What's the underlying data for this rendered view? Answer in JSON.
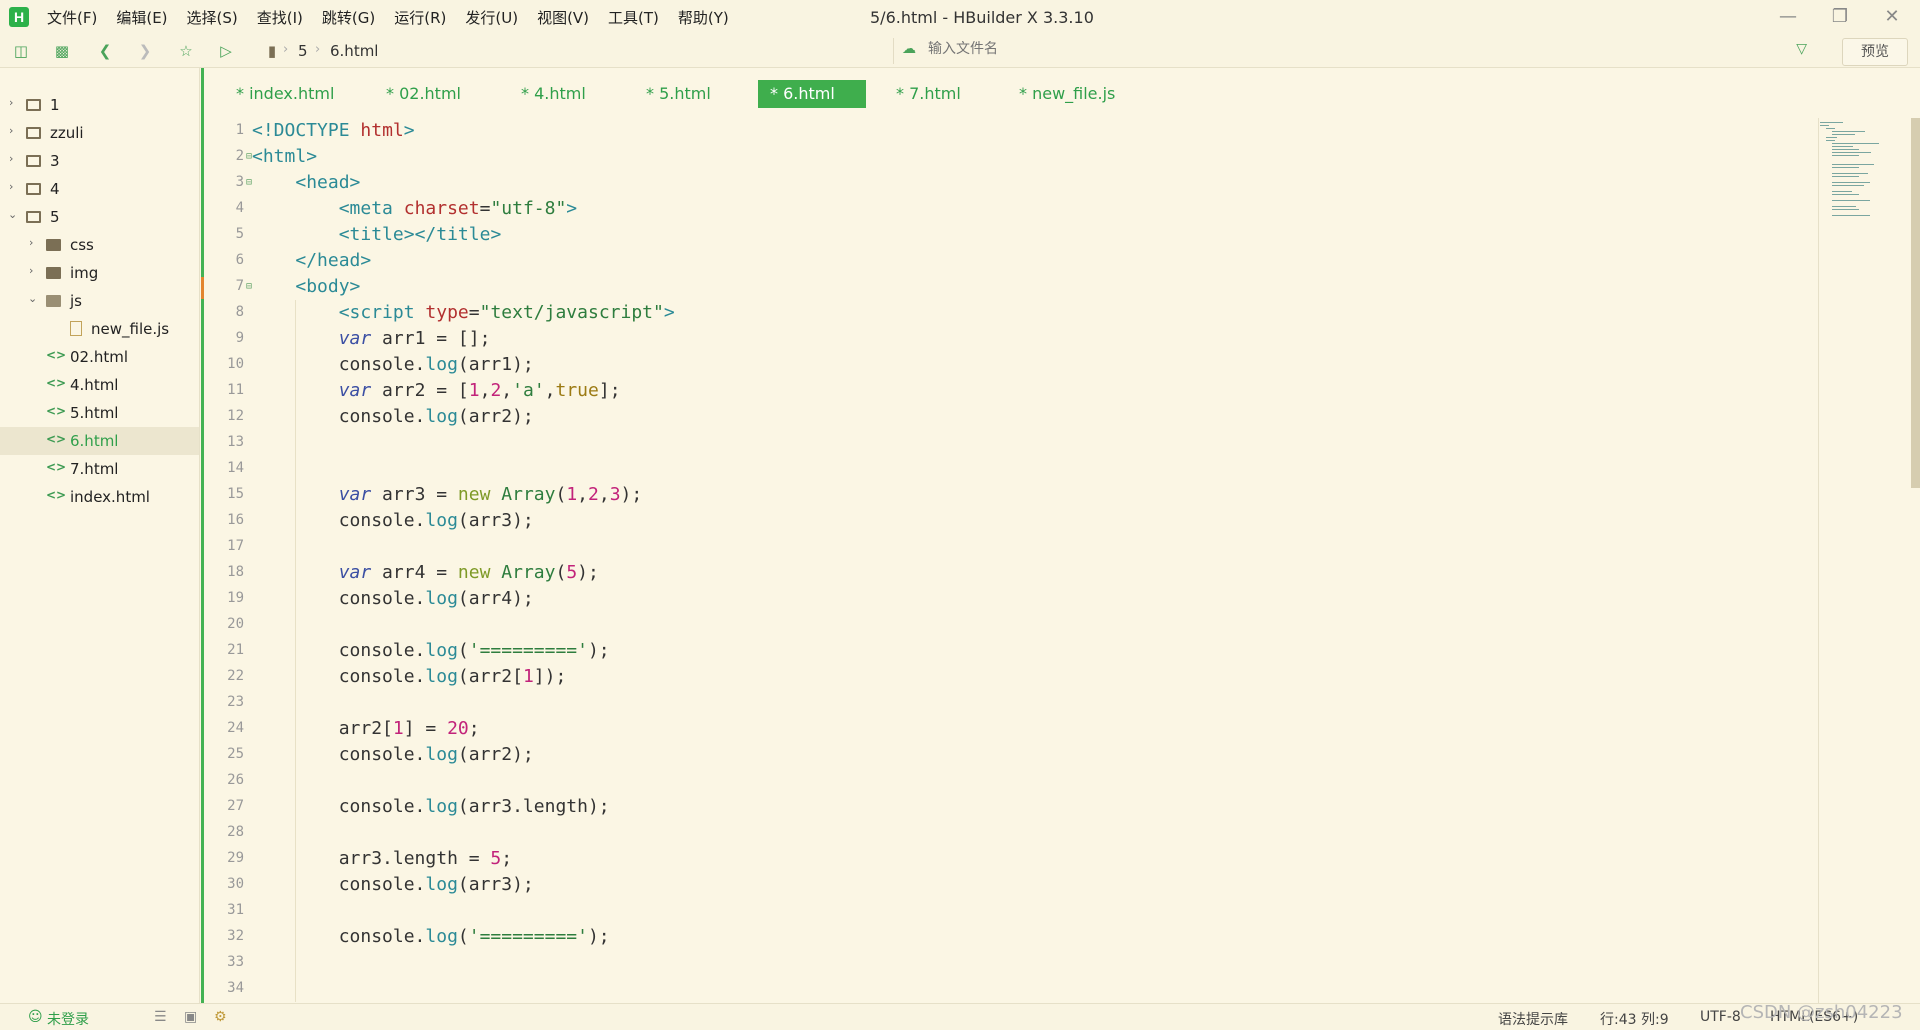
{
  "window": {
    "title": "5/6.html - HBuilder X 3.3.10",
    "logo": "H",
    "menu": [
      "文件(F)",
      "编辑(E)",
      "选择(S)",
      "查找(I)",
      "跳转(G)",
      "运行(R)",
      "发行(U)",
      "视图(V)",
      "工具(T)",
      "帮助(Y)"
    ]
  },
  "toolbar": {
    "breadcrumb": [
      "5",
      "6.html"
    ],
    "file_search_placeholder": "输入文件名",
    "preview_label": "预览"
  },
  "sidebar": {
    "items": [
      {
        "label": "1",
        "type": "project",
        "expanded": false
      },
      {
        "label": "zzuli",
        "type": "project",
        "expanded": false
      },
      {
        "label": "3",
        "type": "project",
        "expanded": false
      },
      {
        "label": "4",
        "type": "project",
        "expanded": false
      },
      {
        "label": "5",
        "type": "project",
        "expanded": true
      },
      {
        "label": "css",
        "type": "folder",
        "expanded": false
      },
      {
        "label": "img",
        "type": "folder",
        "expanded": false
      },
      {
        "label": "js",
        "type": "folder",
        "expanded": true
      },
      {
        "label": "new_file.js",
        "type": "js"
      },
      {
        "label": "02.html",
        "type": "html"
      },
      {
        "label": "4.html",
        "type": "html"
      },
      {
        "label": "5.html",
        "type": "html"
      },
      {
        "label": "6.html",
        "type": "html",
        "selected": true
      },
      {
        "label": "7.html",
        "type": "html"
      },
      {
        "label": "index.html",
        "type": "html"
      }
    ]
  },
  "tabs": [
    {
      "label": "* index.html"
    },
    {
      "label": "* 02.html"
    },
    {
      "label": "* 4.html"
    },
    {
      "label": "* 5.html"
    },
    {
      "label": "* 6.html",
      "active": true
    },
    {
      "label": "* 7.html"
    },
    {
      "label": "* new_file.js"
    }
  ],
  "editor": {
    "line_numbers": [
      "1",
      "2",
      "3",
      "4",
      "5",
      "6",
      "7",
      "8",
      "9",
      "10",
      "11",
      "12",
      "13",
      "14",
      "15",
      "16",
      "17",
      "18",
      "19",
      "20",
      "21",
      "22",
      "23",
      "24",
      "25",
      "26",
      "27",
      "28",
      "29",
      "30",
      "31",
      "32",
      "33",
      "34"
    ],
    "lines": [
      "<!DOCTYPE html>",
      "<html>",
      "    <head>",
      "        <meta charset=\"utf-8\">",
      "        <title></title>",
      "    </head>",
      "    <body>",
      "        <script type=\"text/javascript\">",
      "        var arr1 = [];",
      "        console.log(arr1);",
      "        var arr2 = [1,2,'a',true];",
      "        console.log(arr2);",
      "",
      "",
      "        var arr3 = new Array(1,2,3);",
      "        console.log(arr3);",
      "",
      "        var arr4 = new Array(5);",
      "        console.log(arr4);",
      "",
      "        console.log('=========');",
      "        console.log(arr2[1]);",
      "",
      "        arr2[1] = 20;",
      "        console.log(arr2);",
      "",
      "        console.log(arr3.length);",
      "",
      "        arr3.length = 5;",
      "        console.log(arr3);",
      "",
      "        console.log('=========');",
      "",
      ""
    ]
  },
  "statusbar": {
    "login": "未登录",
    "syntax_lib": "语法提示库",
    "position": "行:43  列:9",
    "encoding": "UTF-8",
    "language": "HTML(ES6+)"
  },
  "watermark": "CSDN @zsh04223",
  "colors": {
    "accent": "#3fae4d",
    "background": "#fbf6e4"
  }
}
